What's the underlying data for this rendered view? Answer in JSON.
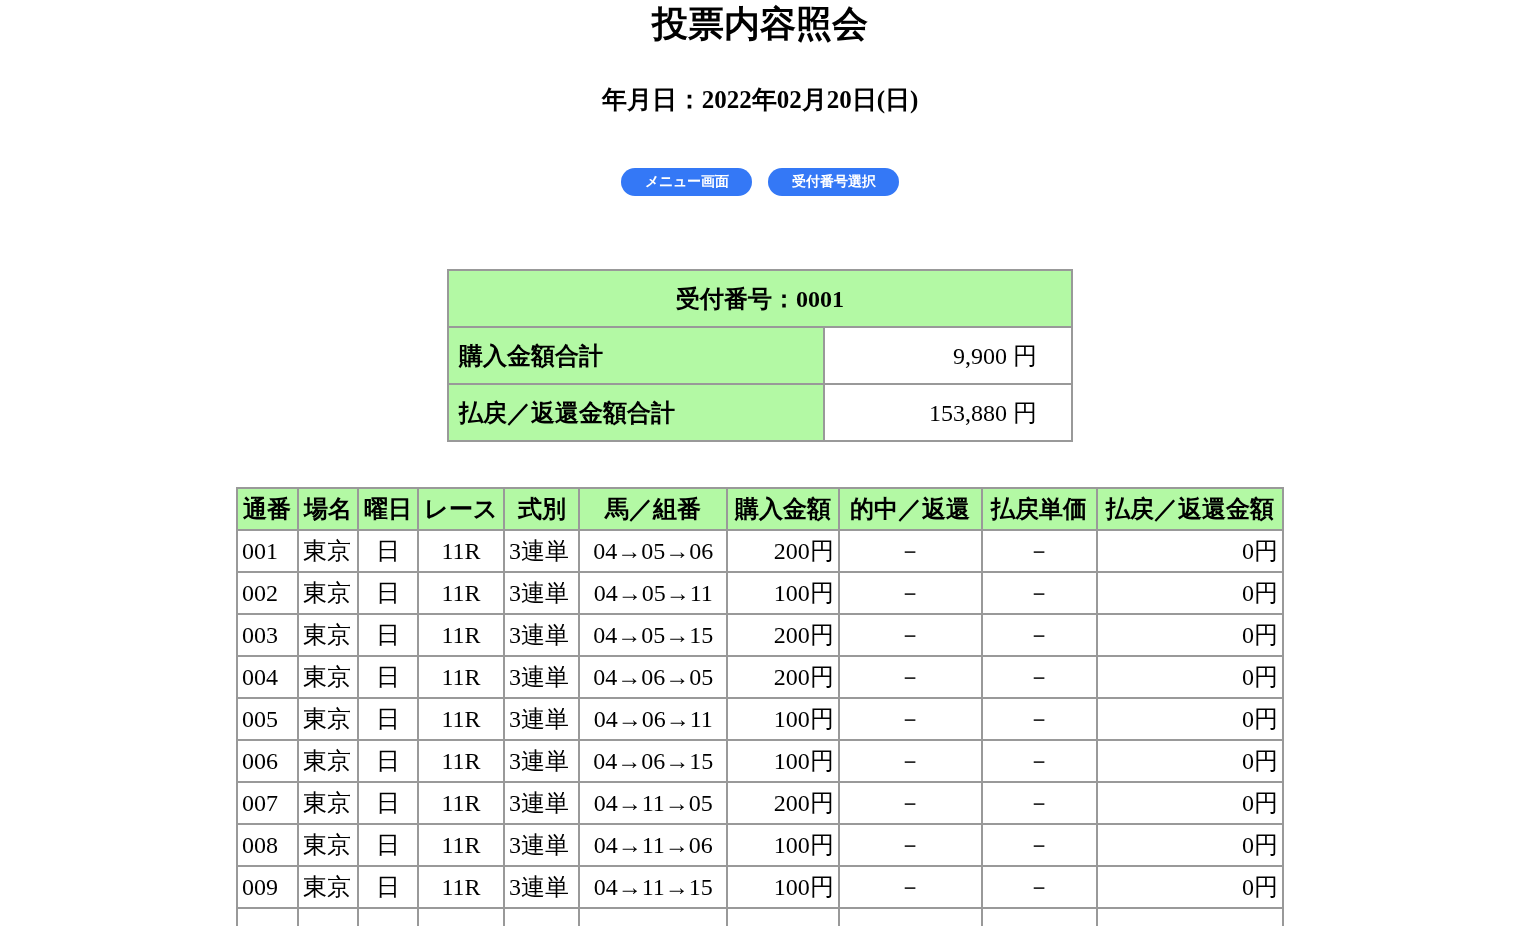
{
  "title": "投票内容照会",
  "date_line": "年月日：2022年02月20日(日)",
  "buttons": [
    "メニュー画面",
    "受付番号選択"
  ],
  "summary": {
    "heading": "受付番号：0001",
    "rows": [
      {
        "label": "購入金額合計",
        "value": "9,900 円"
      },
      {
        "label": "払戻／返還金額合計",
        "value": "153,880 円"
      }
    ]
  },
  "table": {
    "columns": [
      "通番",
      "場名",
      "曜日",
      "レース",
      "式別",
      "馬／組番",
      "購入金額",
      "的中／返還",
      "払戻単価",
      "払戻／返還金額"
    ],
    "rows": [
      [
        "001",
        "東京",
        "日",
        "11R",
        "3連単",
        "04→05→06",
        "200円",
        "－",
        "－",
        "0円"
      ],
      [
        "002",
        "東京",
        "日",
        "11R",
        "3連単",
        "04→05→11",
        "100円",
        "－",
        "－",
        "0円"
      ],
      [
        "003",
        "東京",
        "日",
        "11R",
        "3連単",
        "04→05→15",
        "200円",
        "－",
        "－",
        "0円"
      ],
      [
        "004",
        "東京",
        "日",
        "11R",
        "3連単",
        "04→06→05",
        "200円",
        "－",
        "－",
        "0円"
      ],
      [
        "005",
        "東京",
        "日",
        "11R",
        "3連単",
        "04→06→11",
        "100円",
        "－",
        "－",
        "0円"
      ],
      [
        "006",
        "東京",
        "日",
        "11R",
        "3連単",
        "04→06→15",
        "100円",
        "－",
        "－",
        "0円"
      ],
      [
        "007",
        "東京",
        "日",
        "11R",
        "3連単",
        "04→11→05",
        "200円",
        "－",
        "－",
        "0円"
      ],
      [
        "008",
        "東京",
        "日",
        "11R",
        "3連単",
        "04→11→06",
        "100円",
        "－",
        "－",
        "0円"
      ],
      [
        "009",
        "東京",
        "日",
        "11R",
        "3連単",
        "04→11→15",
        "100円",
        "－",
        "－",
        "0円"
      ]
    ]
  }
}
